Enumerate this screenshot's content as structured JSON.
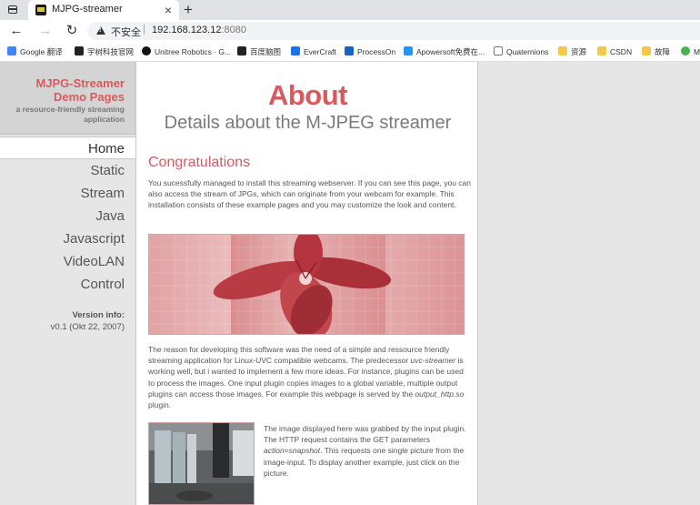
{
  "browser": {
    "tab_title": "MJPG-streamer",
    "tab_close": "×",
    "new_tab": "+",
    "back": "←",
    "forward": "→",
    "reload": "↻",
    "insecure_label": "不安全",
    "address_host": "192.168.123.12",
    "address_port": ":8080",
    "bookmarks": [
      {
        "label": "Google 翻译",
        "icon_color": "#4285f4"
      },
      {
        "label": "宇树科技官网",
        "icon_color": "#222222"
      },
      {
        "label": "Unitree Robotics · G...",
        "icon_color": "#111111"
      },
      {
        "label": "百度脑图",
        "icon_color": "#222222"
      },
      {
        "label": "EverCraft",
        "icon_color": "#1a73e8"
      },
      {
        "label": "ProcessOn",
        "icon_color": "#1565c0"
      },
      {
        "label": "Apowersoft免费在...",
        "icon_color": "#2196f3"
      },
      {
        "label": "Quaternions",
        "icon_color": "#ffffff"
      },
      {
        "label": "资源",
        "icon_color": "#f2c94c"
      },
      {
        "label": "CSDN",
        "icon_color": "#f2c94c"
      },
      {
        "label": "故障",
        "icon_color": "#f2c94c"
      },
      {
        "label": "M",
        "icon_color": "#4caf50"
      }
    ]
  },
  "sidebar": {
    "brand_line1": "MJPG-Streamer",
    "brand_line2": "Demo Pages",
    "brand_sub": "a resource-friendly streaming application",
    "nav": [
      "Home",
      "Static",
      "Stream",
      "Java",
      "Javascript",
      "VideoLAN",
      "Control"
    ],
    "active": "Home",
    "version_label": "Version info:",
    "version_value": "v0.1 (Okt 22, 2007)"
  },
  "content": {
    "title": "About",
    "subtitle": "Details about the M-JPEG streamer",
    "congrats_heading": "Congratulations",
    "para1": "You sucessfully managed to install this streaming webserver. If you can see this page, you can also access the stream of JPGs, which can originate from your webcam for example. This installation consists of these example pages and you may customize the look and content.",
    "para2_a": "The reason for developing this software was the need of a simple and ressource friendly streaming application for Linux-UVC compatible webcams. The predecessor ",
    "para2_em1": "uvc-streamer",
    "para2_b": " is working well, but i wanted to implement a few more ideas. For instance, plugins can be used to process the images. One input plugin copies images to a global variable, multiple output plugins can access those images. For example this webpage is served by the ",
    "para2_em2": "output_http.so",
    "para2_c": " plugin.",
    "para3_a": "The image displayed here was grabbed by the input plugin. The HTTP request contains the GET parameters ",
    "para3_em": "action=snapshot",
    "para3_b": ". This requests one single picture from the image-input. To display another example, just click on the picture."
  },
  "colors": {
    "accent": "#d9595f",
    "sidebar_bg": "#e6e6e6",
    "header_bg": "#d4d4d4"
  }
}
